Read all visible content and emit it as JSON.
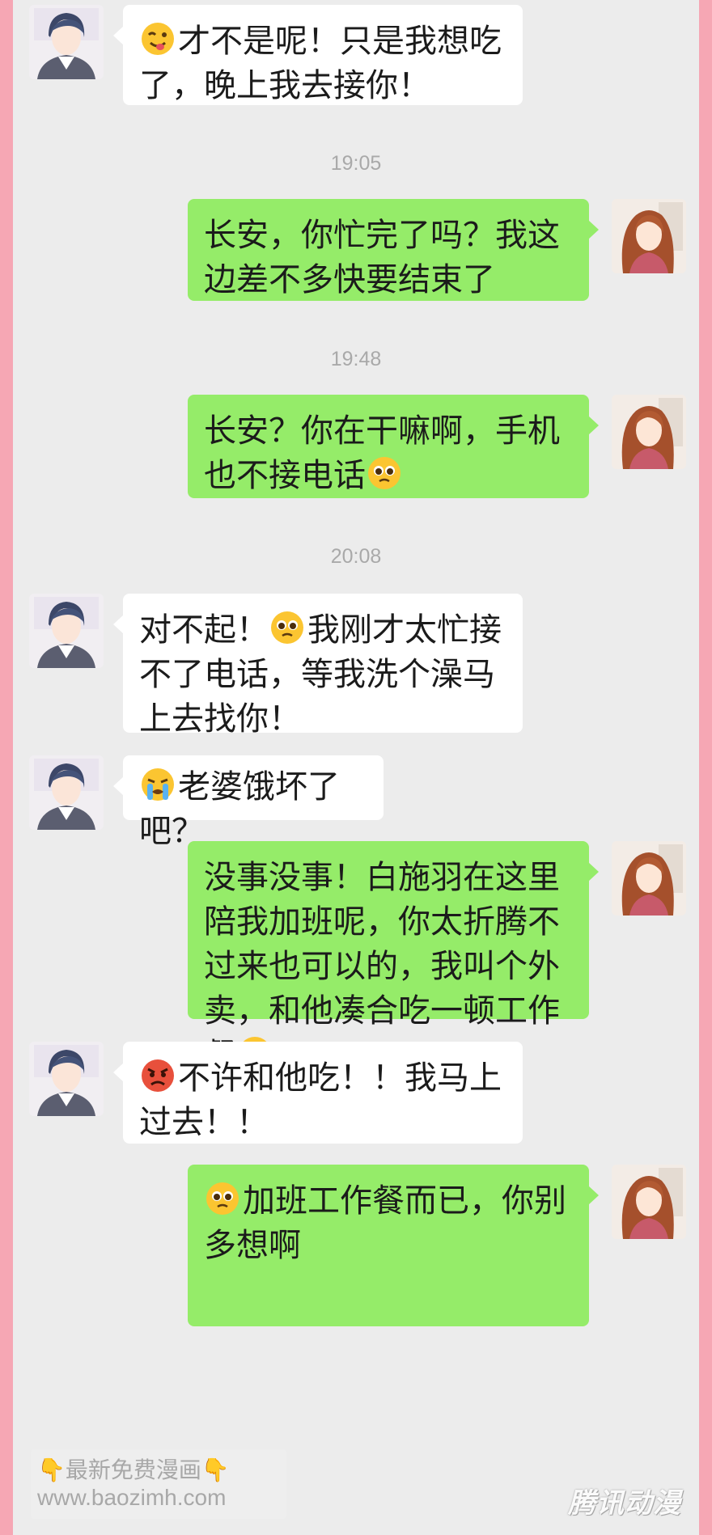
{
  "timestamps": [
    "19:05",
    "19:48",
    "20:08"
  ],
  "messages": [
    {
      "side": "left",
      "emoji": "wink-tongue-emoji",
      "text": "才不是呢！只是我想吃了，晚上我去接你！"
    },
    {
      "side": "right",
      "text": "长安，你忙完了吗？我这边差不多快要结束了"
    },
    {
      "side": "right",
      "text": "长安？你在干嘛啊，手机也不接电话",
      "emoji_after": "pleading-emoji"
    },
    {
      "side": "left",
      "text_a": "对不起！",
      "emoji": "pleading-emoji",
      "text_b": "我刚才太忙接不了电话，等我洗个澡马上去找你！"
    },
    {
      "side": "left",
      "emoji": "crying-emoji",
      "text": "老婆饿坏了吧？"
    },
    {
      "side": "right",
      "text": "没事没事！白施羽在这里陪我加班呢，你太折腾不过来也可以的，我叫个外卖，和他凑合吃一顿工作餐",
      "emoji_after": "smirk-emoji"
    },
    {
      "side": "left",
      "emoji": "angry-emoji",
      "text": "不许和他吃！！我马上过去！！"
    },
    {
      "side": "right",
      "emoji": "pleading-emoji",
      "text": "加班工作餐而已，你别多想啊"
    }
  ],
  "watermark": {
    "line1": "最新免费漫画",
    "line2": "www.baozimh.com",
    "hand": "👇"
  },
  "logo": "腾讯动漫",
  "colors": {
    "frame": "#f6a7b4",
    "chat_bg": "#ececec",
    "sent_bubble": "#95ec69",
    "received_bubble": "#ffffff"
  }
}
